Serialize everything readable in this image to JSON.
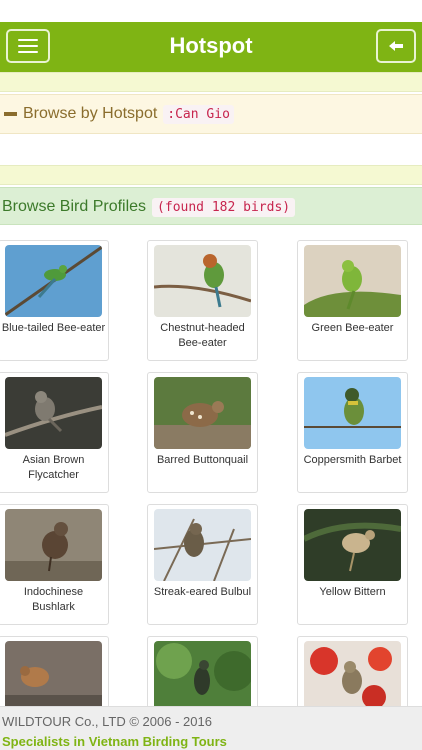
{
  "navbar": {
    "title": "Hotspot",
    "menu_icon": "hamburger-icon",
    "back_icon": "arrow-left-icon",
    "color": "#7fb414"
  },
  "hotspot": {
    "label": "Browse by Hotspot",
    "value": ":Can Gio"
  },
  "profiles": {
    "label": "Browse Bird Profiles",
    "count": "(found 182 birds)"
  },
  "birds": [
    {
      "name": "Blue-tailed Bee-eater"
    },
    {
      "name": "Chestnut-headed Bee-eater"
    },
    {
      "name": "Green Bee-eater"
    },
    {
      "name": "Asian Brown Flycatcher"
    },
    {
      "name": "Barred Buttonquail"
    },
    {
      "name": "Coppersmith Barbet"
    },
    {
      "name": "Indochinese Bushlark"
    },
    {
      "name": "Streak-eared Bulbul"
    },
    {
      "name": "Yellow Bittern"
    },
    {
      "name": ""
    },
    {
      "name": ""
    },
    {
      "name": ""
    }
  ],
  "footer": {
    "copyright": "WILDTOUR Co., LTD © 2006 - 2016",
    "tagline": "Specialists in Vietnam Birding Tours"
  }
}
